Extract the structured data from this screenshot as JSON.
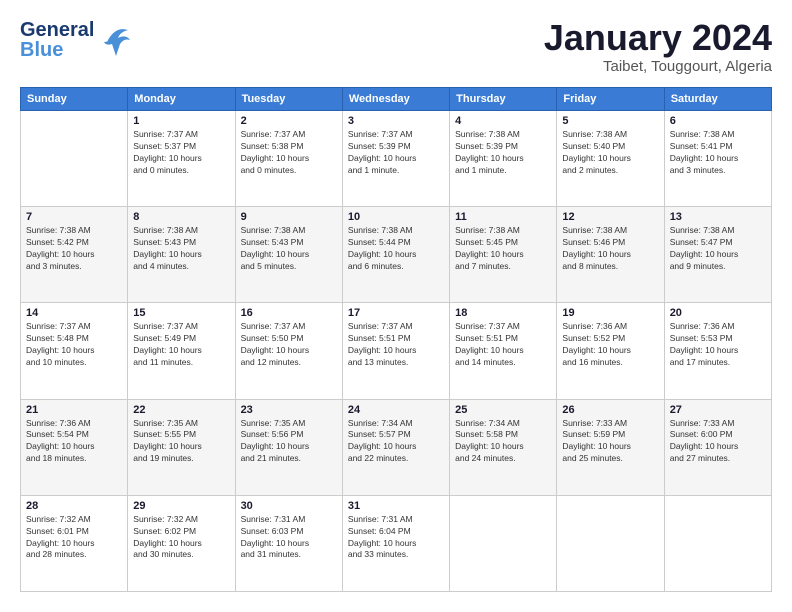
{
  "logo": {
    "line1": "General",
    "line2": "Blue"
  },
  "title": "January 2024",
  "subtitle": "Taibet, Touggourt, Algeria",
  "days": [
    "Sunday",
    "Monday",
    "Tuesday",
    "Wednesday",
    "Thursday",
    "Friday",
    "Saturday"
  ],
  "cells": [
    [
      {
        "day": "",
        "info": ""
      },
      {
        "day": "1",
        "info": "Sunrise: 7:37 AM\nSunset: 5:37 PM\nDaylight: 10 hours\nand 0 minutes."
      },
      {
        "day": "2",
        "info": "Sunrise: 7:37 AM\nSunset: 5:38 PM\nDaylight: 10 hours\nand 0 minutes."
      },
      {
        "day": "3",
        "info": "Sunrise: 7:37 AM\nSunset: 5:39 PM\nDaylight: 10 hours\nand 1 minute."
      },
      {
        "day": "4",
        "info": "Sunrise: 7:38 AM\nSunset: 5:39 PM\nDaylight: 10 hours\nand 1 minute."
      },
      {
        "day": "5",
        "info": "Sunrise: 7:38 AM\nSunset: 5:40 PM\nDaylight: 10 hours\nand 2 minutes."
      },
      {
        "day": "6",
        "info": "Sunrise: 7:38 AM\nSunset: 5:41 PM\nDaylight: 10 hours\nand 3 minutes."
      }
    ],
    [
      {
        "day": "7",
        "info": "Sunrise: 7:38 AM\nSunset: 5:42 PM\nDaylight: 10 hours\nand 3 minutes."
      },
      {
        "day": "8",
        "info": "Sunrise: 7:38 AM\nSunset: 5:43 PM\nDaylight: 10 hours\nand 4 minutes."
      },
      {
        "day": "9",
        "info": "Sunrise: 7:38 AM\nSunset: 5:43 PM\nDaylight: 10 hours\nand 5 minutes."
      },
      {
        "day": "10",
        "info": "Sunrise: 7:38 AM\nSunset: 5:44 PM\nDaylight: 10 hours\nand 6 minutes."
      },
      {
        "day": "11",
        "info": "Sunrise: 7:38 AM\nSunset: 5:45 PM\nDaylight: 10 hours\nand 7 minutes."
      },
      {
        "day": "12",
        "info": "Sunrise: 7:38 AM\nSunset: 5:46 PM\nDaylight: 10 hours\nand 8 minutes."
      },
      {
        "day": "13",
        "info": "Sunrise: 7:38 AM\nSunset: 5:47 PM\nDaylight: 10 hours\nand 9 minutes."
      }
    ],
    [
      {
        "day": "14",
        "info": "Sunrise: 7:37 AM\nSunset: 5:48 PM\nDaylight: 10 hours\nand 10 minutes."
      },
      {
        "day": "15",
        "info": "Sunrise: 7:37 AM\nSunset: 5:49 PM\nDaylight: 10 hours\nand 11 minutes."
      },
      {
        "day": "16",
        "info": "Sunrise: 7:37 AM\nSunset: 5:50 PM\nDaylight: 10 hours\nand 12 minutes."
      },
      {
        "day": "17",
        "info": "Sunrise: 7:37 AM\nSunset: 5:51 PM\nDaylight: 10 hours\nand 13 minutes."
      },
      {
        "day": "18",
        "info": "Sunrise: 7:37 AM\nSunset: 5:51 PM\nDaylight: 10 hours\nand 14 minutes."
      },
      {
        "day": "19",
        "info": "Sunrise: 7:36 AM\nSunset: 5:52 PM\nDaylight: 10 hours\nand 16 minutes."
      },
      {
        "day": "20",
        "info": "Sunrise: 7:36 AM\nSunset: 5:53 PM\nDaylight: 10 hours\nand 17 minutes."
      }
    ],
    [
      {
        "day": "21",
        "info": "Sunrise: 7:36 AM\nSunset: 5:54 PM\nDaylight: 10 hours\nand 18 minutes."
      },
      {
        "day": "22",
        "info": "Sunrise: 7:35 AM\nSunset: 5:55 PM\nDaylight: 10 hours\nand 19 minutes."
      },
      {
        "day": "23",
        "info": "Sunrise: 7:35 AM\nSunset: 5:56 PM\nDaylight: 10 hours\nand 21 minutes."
      },
      {
        "day": "24",
        "info": "Sunrise: 7:34 AM\nSunset: 5:57 PM\nDaylight: 10 hours\nand 22 minutes."
      },
      {
        "day": "25",
        "info": "Sunrise: 7:34 AM\nSunset: 5:58 PM\nDaylight: 10 hours\nand 24 minutes."
      },
      {
        "day": "26",
        "info": "Sunrise: 7:33 AM\nSunset: 5:59 PM\nDaylight: 10 hours\nand 25 minutes."
      },
      {
        "day": "27",
        "info": "Sunrise: 7:33 AM\nSunset: 6:00 PM\nDaylight: 10 hours\nand 27 minutes."
      }
    ],
    [
      {
        "day": "28",
        "info": "Sunrise: 7:32 AM\nSunset: 6:01 PM\nDaylight: 10 hours\nand 28 minutes."
      },
      {
        "day": "29",
        "info": "Sunrise: 7:32 AM\nSunset: 6:02 PM\nDaylight: 10 hours\nand 30 minutes."
      },
      {
        "day": "30",
        "info": "Sunrise: 7:31 AM\nSunset: 6:03 PM\nDaylight: 10 hours\nand 31 minutes."
      },
      {
        "day": "31",
        "info": "Sunrise: 7:31 AM\nSunset: 6:04 PM\nDaylight: 10 hours\nand 33 minutes."
      },
      {
        "day": "",
        "info": ""
      },
      {
        "day": "",
        "info": ""
      },
      {
        "day": "",
        "info": ""
      }
    ]
  ]
}
